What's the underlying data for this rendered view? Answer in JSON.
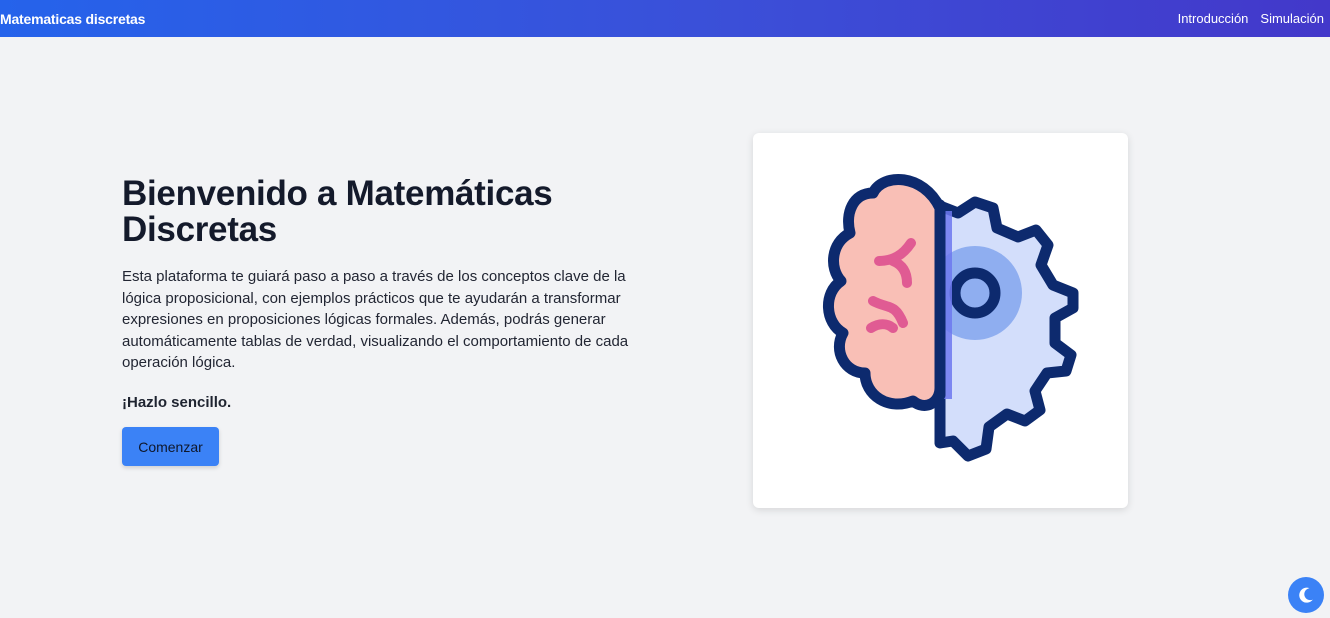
{
  "navbar": {
    "brand": "Matematicas discretas",
    "links": [
      "Introducción",
      "Simulación"
    ]
  },
  "hero": {
    "title": "Bienvenido a Matemáticas Discretas",
    "description": "Esta plataforma te guiará paso a paso a través de los conceptos clave de la lógica proposicional, con ejemplos prácticos que te ayudarán a transformar expresiones en proposiciones lógicas formales. Además, podrás generar automáticamente tablas de verdad, visualizando el comportamiento de cada operación lógica.",
    "tagline": "¡Hazlo sencillo.",
    "button_label": "Comenzar"
  },
  "illustration": {
    "icon": "brain-gear-icon"
  },
  "theme_toggle": {
    "icon": "moon-icon"
  },
  "colors": {
    "nav_start": "#2563eb",
    "nav_end": "#4338ca",
    "accent": "#3b82f6",
    "background": "#f2f3f5"
  }
}
